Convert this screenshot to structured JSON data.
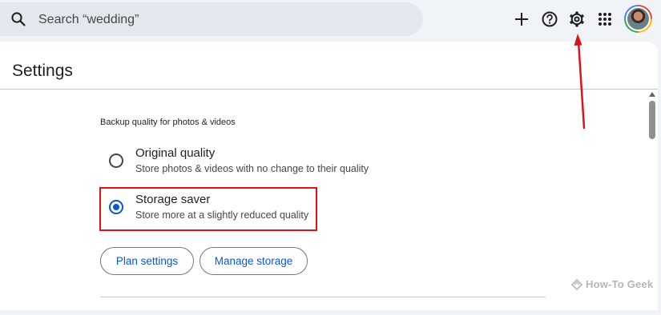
{
  "search": {
    "placeholder": "Search “wedding”",
    "icon": "search-icon"
  },
  "toolbar": {
    "icons": [
      "add-icon",
      "help-icon",
      "settings-gear-icon",
      "apps-grid-icon"
    ],
    "avatar_icon": "account-avatar"
  },
  "settings": {
    "title": "Settings",
    "section_label": "Backup quality for photos & videos",
    "options": [
      {
        "title": "Original quality",
        "description": "Store photos & videos with no change to their quality",
        "selected": false
      },
      {
        "title": "Storage saver",
        "description": "Store more at a slightly reduced quality",
        "selected": true
      }
    ],
    "buttons": {
      "plan": "Plan settings",
      "storage": "Manage storage"
    }
  },
  "watermark": "How-To Geek",
  "colors": {
    "accent": "#0b57d0",
    "annotation_red": "#d9141c",
    "background": "#f0f4f9",
    "panel": "#ffffff"
  }
}
